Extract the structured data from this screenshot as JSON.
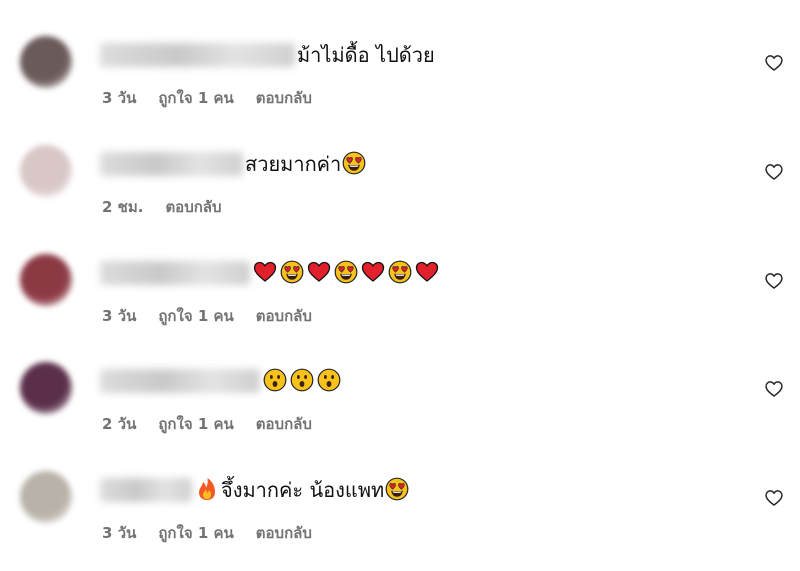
{
  "comments": [
    {
      "text": "ม้าไม่ดื้อ ไปด้วย",
      "emojis": [],
      "meta": {
        "time": "3 วัน",
        "likes": "ถูกใจ 1 คน",
        "reply": "ตอบกลับ"
      },
      "avatar_color": "#6b5a5a",
      "username_width": 195
    },
    {
      "text": "สวยมากค่า",
      "emojis": [
        "heart-eyes"
      ],
      "meta": {
        "time": "2 ชม.",
        "likes": "",
        "reply": "ตอบกลับ"
      },
      "avatar_color": "#d9c7c7",
      "username_width": 143
    },
    {
      "text": "",
      "emojis": [
        "red-heart",
        "heart-eyes",
        "red-heart",
        "heart-eyes",
        "red-heart",
        "heart-eyes",
        "red-heart"
      ],
      "meta": {
        "time": "3 วัน",
        "likes": "ถูกใจ 1 คน",
        "reply": "ตอบกลับ"
      },
      "avatar_color": "#8b3a44",
      "username_width": 150
    },
    {
      "text": "",
      "emojis": [
        "open-mouth",
        "open-mouth",
        "open-mouth"
      ],
      "meta": {
        "time": "2 วัน",
        "likes": "ถูกใจ 1 คน",
        "reply": "ตอบกลับ"
      },
      "avatar_color": "#5b2f4a",
      "username_width": 160
    },
    {
      "text": "จึ้งมากค่ะ น้องแพท",
      "emojis_before": [
        "fire"
      ],
      "emojis": [
        "heart-eyes"
      ],
      "meta": {
        "time": "3 วัน",
        "likes": "ถูกใจ 1 คน",
        "reply": "ตอบกลับ"
      },
      "avatar_color": "#b9b2a8",
      "username_width": 92
    }
  ],
  "icons": {
    "like": "heart-outline-icon"
  },
  "colors": {
    "meta_text": "#737373",
    "text": "#111111",
    "heart_red": "#e0202a",
    "emoji_yellow": "#f8c21a"
  }
}
